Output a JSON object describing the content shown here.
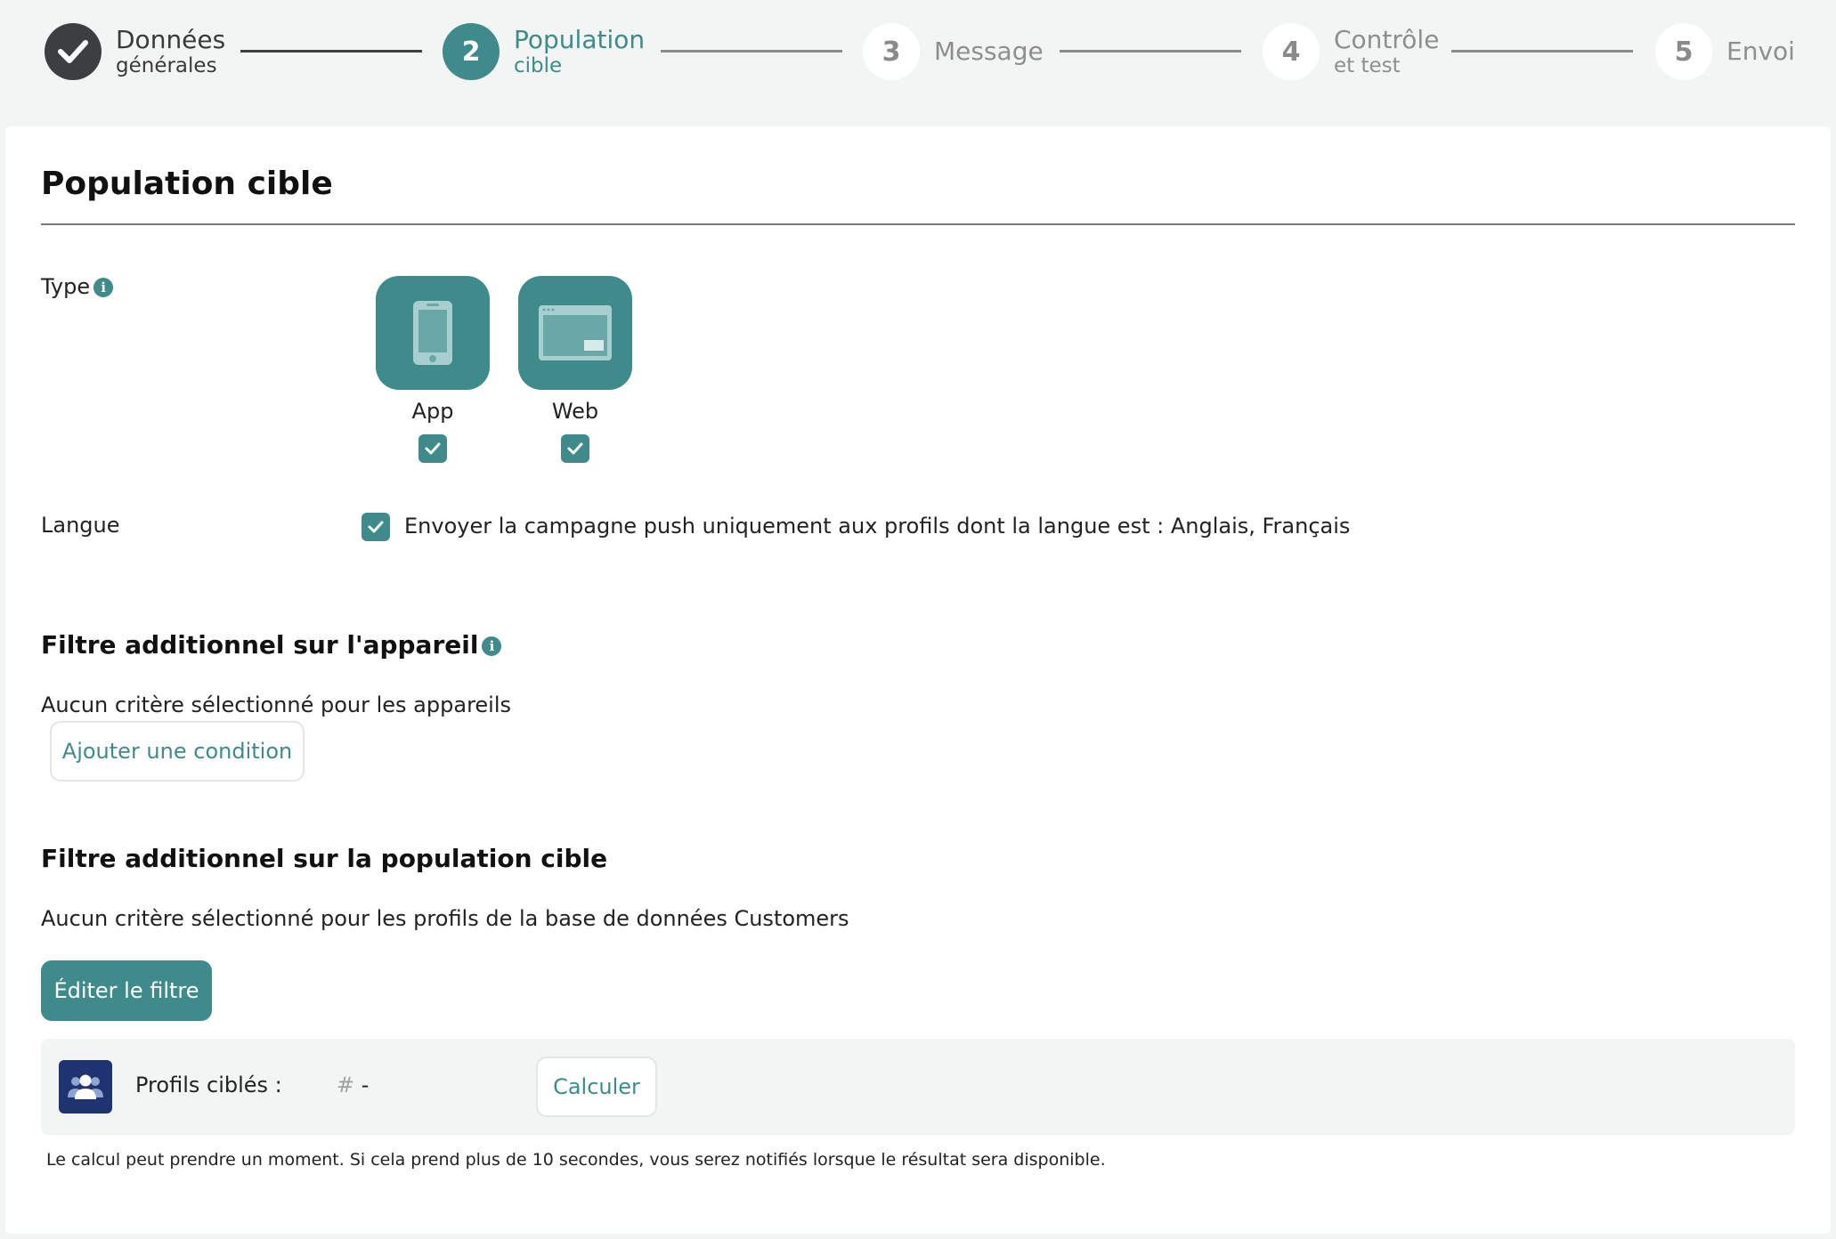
{
  "stepper": {
    "steps": [
      {
        "number": "",
        "title": "Données",
        "sub": "générales",
        "state": "done"
      },
      {
        "number": "2",
        "title": "Population",
        "sub": "cible",
        "state": "active"
      },
      {
        "number": "3",
        "title": "Message",
        "sub": "",
        "state": "todo"
      },
      {
        "number": "4",
        "title": "Contrôle",
        "sub": "et test",
        "state": "todo"
      },
      {
        "number": "5",
        "title": "Envoi",
        "sub": "",
        "state": "todo"
      }
    ]
  },
  "page": {
    "title": "Population cible"
  },
  "type": {
    "label": "Type",
    "info_icon": "i",
    "options": [
      {
        "label": "App",
        "icon": "mobile-phone-icon",
        "checked": true
      },
      {
        "label": "Web",
        "icon": "browser-window-icon",
        "checked": true
      }
    ]
  },
  "langue": {
    "label": "Langue",
    "checked": true,
    "text": "Envoyer la campagne push uniquement aux profils dont la langue est : Anglais, Français"
  },
  "device_filter": {
    "title": "Filtre additionnel sur l'appareil",
    "info_icon": "i",
    "empty_text": "Aucun critère sélectionné pour les appareils",
    "add_button": "Ajouter une condition"
  },
  "population_filter": {
    "title": "Filtre additionnel sur la population cible",
    "empty_text": "Aucun critère sélectionné pour les profils de la base de données Customers",
    "edit_button": "Éditer le filtre"
  },
  "profiles": {
    "label": "Profils ciblés :",
    "hash": "#",
    "value": "-",
    "compute_button": "Calculer",
    "icon": "users-icon"
  },
  "footnote": "Le calcul peut prendre un moment. Si cela prend plus de 10 secondes, vous serez notifiés lorsque le résultat sera disponible.",
  "colors": {
    "accent": "#3f8b8b",
    "done": "#3d3e40",
    "profile_icon_bg": "#1f3370"
  }
}
